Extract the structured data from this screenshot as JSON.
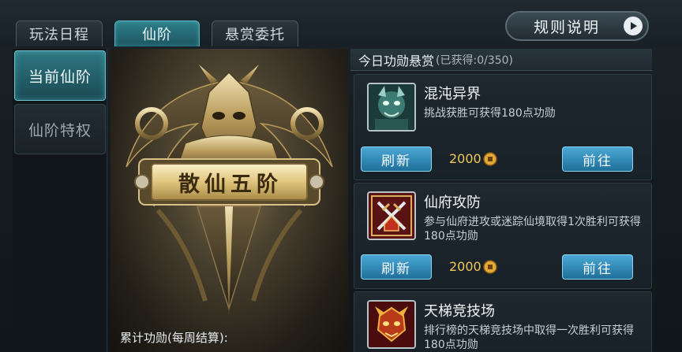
{
  "tabs": [
    {
      "label": "玩法日程",
      "active": false
    },
    {
      "label": "仙阶",
      "active": true
    },
    {
      "label": "悬赏委托",
      "active": false
    }
  ],
  "rules_button": {
    "label": "规则说明",
    "icon": "play-arrow-icon"
  },
  "sidebar": {
    "items": [
      {
        "label": "当前仙阶",
        "active": true
      },
      {
        "label": "仙阶特权",
        "active": false
      }
    ]
  },
  "rank": {
    "plaque_text": "散仙五阶",
    "merit_label": "累计功勋(每周结算):"
  },
  "bounty": {
    "title": "今日功勋悬赏",
    "obtained": "(已获得:0/350)",
    "quests": [
      {
        "name": "混沌异界",
        "desc": "挑战获胜可获得180点功勋",
        "icon": "demon-warrior-icon",
        "refresh_label": "刷新",
        "cost": "2000",
        "go_label": "前往"
      },
      {
        "name": "仙府攻防",
        "desc": "参与仙府进攻或迷踪仙境取得1次胜利可获得180点功勋",
        "icon": "crossed-swords-icon",
        "refresh_label": "刷新",
        "cost": "2000",
        "go_label": "前往"
      },
      {
        "name": "天梯竞技场",
        "desc": "排行榜的天梯竞技场中取得一次胜利可获得180点功勋",
        "icon": "demon-mask-icon"
      }
    ]
  },
  "colors": {
    "accent_teal": "#2f7f8a",
    "button_blue": "#2f8fc0",
    "gold_text": "#f0c85a"
  }
}
